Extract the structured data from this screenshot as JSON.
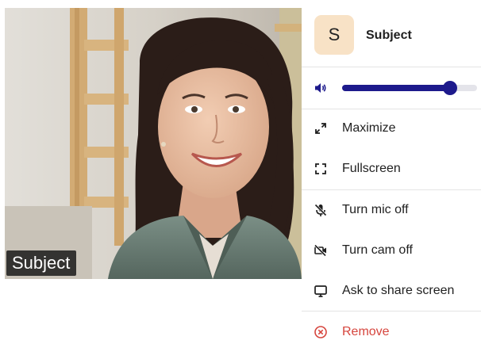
{
  "video": {
    "participant_label": "Subject"
  },
  "menu": {
    "header": {
      "avatar_initial": "S",
      "name": "Subject"
    },
    "volume": {
      "level": 0.8
    },
    "items": [
      {
        "label": "Maximize",
        "icon": "maximize-icon"
      },
      {
        "label": "Fullscreen",
        "icon": "fullscreen-icon"
      },
      {
        "label": "Turn mic off",
        "icon": "mic-off-icon"
      },
      {
        "label": "Turn cam off",
        "icon": "camera-off-icon"
      },
      {
        "label": "Ask to share screen",
        "icon": "screen-share-icon"
      },
      {
        "label": "Remove",
        "icon": "remove-icon"
      }
    ]
  },
  "colors": {
    "accent": "#1d1a8c",
    "danger": "#d6453d",
    "avatar_bg": "#f8e2c6",
    "divider": "#e4e4e4"
  }
}
